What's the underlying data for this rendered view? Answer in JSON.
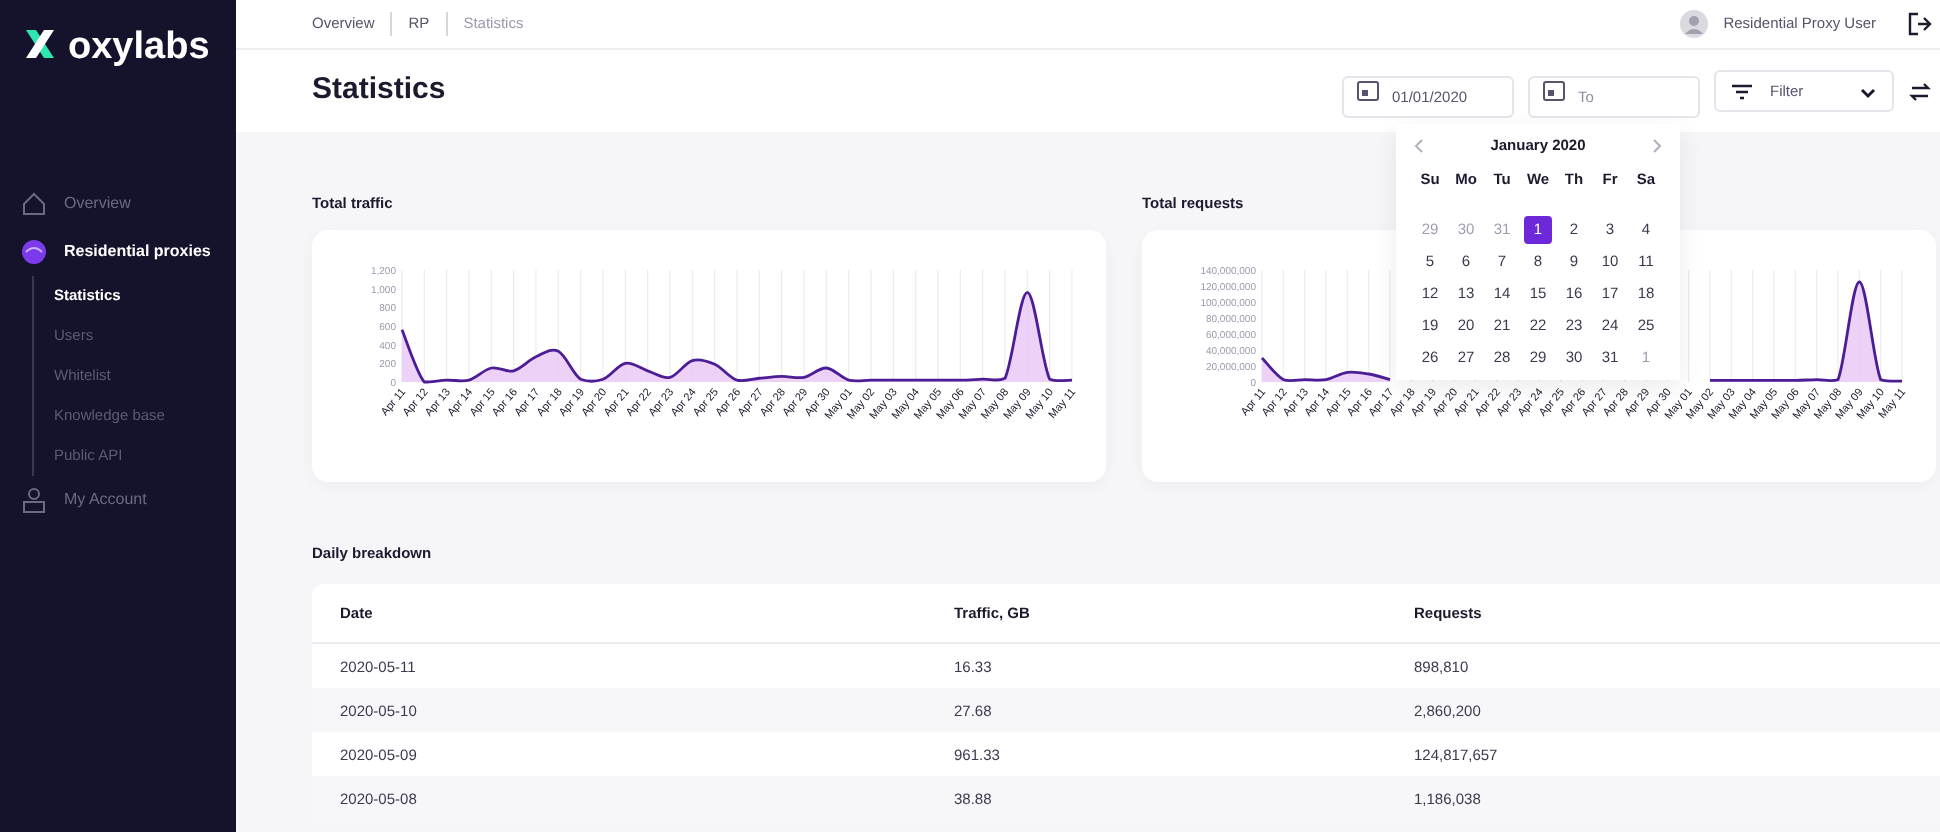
{
  "sidebar": {
    "logo": "oxylabs",
    "items": [
      {
        "label": "Overview",
        "selected": false
      },
      {
        "label": "Residential proxies",
        "selected": true,
        "children": [
          {
            "label": "Statistics",
            "selected": true
          },
          {
            "label": "Users",
            "selected": false
          },
          {
            "label": "Whitelist",
            "selected": false
          },
          {
            "label": "Knowledge base",
            "selected": false
          },
          {
            "label": "Public API",
            "selected": false
          }
        ]
      },
      {
        "label": "My Account",
        "selected": false
      }
    ]
  },
  "breadcrumbs": [
    "Overview",
    "RP",
    "Statistics"
  ],
  "user": {
    "name": "Residential Proxy User"
  },
  "page_title": "Statistics",
  "toolbar": {
    "from_date": {
      "value": "01/01/2020"
    },
    "to_date": {
      "placeholder": "To"
    },
    "filter": {
      "label": "Filter"
    }
  },
  "calendar": {
    "month": "January 2020",
    "weekdays": [
      "Su",
      "Mo",
      "Tu",
      "We",
      "Th",
      "Fr",
      "Sa"
    ],
    "days": [
      {
        "label": "29",
        "muted": true,
        "selected": false
      },
      {
        "label": "30",
        "muted": true,
        "selected": false
      },
      {
        "label": "31",
        "muted": true,
        "selected": false
      },
      {
        "label": "1",
        "muted": false,
        "selected": true
      },
      {
        "label": "2",
        "muted": false,
        "selected": false
      },
      {
        "label": "3",
        "muted": false,
        "selected": false
      },
      {
        "label": "4",
        "muted": false,
        "selected": false
      },
      {
        "label": "5",
        "muted": false,
        "selected": false
      },
      {
        "label": "6",
        "muted": false,
        "selected": false
      },
      {
        "label": "7",
        "muted": false,
        "selected": false
      },
      {
        "label": "8",
        "muted": false,
        "selected": false
      },
      {
        "label": "9",
        "muted": false,
        "selected": false
      },
      {
        "label": "10",
        "muted": false,
        "selected": false
      },
      {
        "label": "11",
        "muted": false,
        "selected": false
      },
      {
        "label": "12",
        "muted": false,
        "selected": false
      },
      {
        "label": "13",
        "muted": false,
        "selected": false
      },
      {
        "label": "14",
        "muted": false,
        "selected": false
      },
      {
        "label": "15",
        "muted": false,
        "selected": false
      },
      {
        "label": "16",
        "muted": false,
        "selected": false
      },
      {
        "label": "17",
        "muted": false,
        "selected": false
      },
      {
        "label": "18",
        "muted": false,
        "selected": false
      },
      {
        "label": "19",
        "muted": false,
        "selected": false
      },
      {
        "label": "20",
        "muted": false,
        "selected": false
      },
      {
        "label": "21",
        "muted": false,
        "selected": false
      },
      {
        "label": "22",
        "muted": false,
        "selected": false
      },
      {
        "label": "23",
        "muted": false,
        "selected": false
      },
      {
        "label": "24",
        "muted": false,
        "selected": false
      },
      {
        "label": "25",
        "muted": false,
        "selected": false
      },
      {
        "label": "26",
        "muted": false,
        "selected": false
      },
      {
        "label": "27",
        "muted": false,
        "selected": false
      },
      {
        "label": "28",
        "muted": false,
        "selected": false
      },
      {
        "label": "29",
        "muted": false,
        "selected": false
      },
      {
        "label": "30",
        "muted": false,
        "selected": false
      },
      {
        "label": "31",
        "muted": false,
        "selected": false
      },
      {
        "label": "1",
        "muted": true,
        "selected": false
      }
    ]
  },
  "charts": [
    {
      "title": "Total traffic",
      "chart_data": {
        "type": "area",
        "grid": true,
        "categories": [
          "Apr 11",
          "Apr 12",
          "Apr 13",
          "Apr 14",
          "Apr 15",
          "Apr 16",
          "Apr 17",
          "Apr 18",
          "Apr 19",
          "Apr 20",
          "Apr 21",
          "Apr 22",
          "Apr 23",
          "Apr 24",
          "Apr 25",
          "Apr 26",
          "Apr 27",
          "Apr 28",
          "Apr 29",
          "Apr 30",
          "May 01",
          "May 02",
          "May 03",
          "May 04",
          "May 05",
          "May 06",
          "May 07",
          "May 08",
          "May 09",
          "May 10",
          "May 11"
        ],
        "series": [
          {
            "color": "#4c1d95",
            "values": [
              560,
              0,
              20,
              20,
              150,
              120,
              270,
              330,
              30,
              30,
              200,
              120,
              50,
              230,
              190,
              20,
              40,
              60,
              50,
              150,
              20,
              20,
              20,
              20,
              20,
              20,
              30,
              40,
              960,
              30,
              20
            ]
          }
        ],
        "ylim": [
          0,
          1200
        ],
        "yticks": [
          {
            "value": 0,
            "label": "0"
          },
          {
            "value": 200,
            "label": "200"
          },
          {
            "value": 400,
            "label": "400"
          },
          {
            "value": 600,
            "label": "600"
          },
          {
            "value": 800,
            "label": "800"
          },
          {
            "value": 1000,
            "label": "1,000"
          },
          {
            "value": 1200,
            "label": "1,200"
          }
        ]
      }
    },
    {
      "title": "Total requests",
      "chart_data": {
        "type": "area",
        "grid": true,
        "categories": [
          "Apr 11",
          "Apr 12",
          "Apr 13",
          "Apr 14",
          "Apr 15",
          "Apr 16",
          "Apr 17",
          "Apr 18",
          "Apr 19",
          "Apr 20",
          "Apr 21",
          "Apr 22",
          "Apr 23",
          "Apr 24",
          "Apr 25",
          "Apr 26",
          "Apr 27",
          "Apr 28",
          "Apr 29",
          "Apr 30",
          "May 01",
          "May 02",
          "May 03",
          "May 04",
          "May 05",
          "May 06",
          "May 07",
          "May 08",
          "May 09",
          "May 10",
          "May 11"
        ],
        "series": [
          {
            "color": "#4c1d95",
            "values": [
              30000000,
              3000000,
              3000000,
              3000000,
              12000000,
              10000000,
              3000000,
              null,
              null,
              null,
              null,
              null,
              null,
              null,
              null,
              null,
              null,
              null,
              null,
              null,
              null,
              2000000,
              2000000,
              2000000,
              2000000,
              2000000,
              3000000,
              3000000,
              125000000,
              3000000,
              1000000
            ]
          }
        ],
        "ylim": [
          0,
          140000000
        ],
        "yticks": [
          {
            "value": 0,
            "label": "0"
          },
          {
            "value": 20000000,
            "label": "20,000,000"
          },
          {
            "value": 40000000,
            "label": "40,000,000"
          },
          {
            "value": 60000000,
            "label": "60,000,000"
          },
          {
            "value": 80000000,
            "label": "80,000,000"
          },
          {
            "value": 100000000,
            "label": "100,000,000"
          },
          {
            "value": 120000000,
            "label": "120,000,000"
          },
          {
            "value": 140000000,
            "label": "140,000,000"
          }
        ]
      }
    }
  ],
  "breakdown": {
    "title": "Daily breakdown",
    "columns": [
      "Date",
      "Traffic, GB",
      "Requests"
    ],
    "rows": [
      [
        "2020-05-11",
        "16.33",
        "898,810"
      ],
      [
        "2020-05-10",
        "27.68",
        "2,860,200"
      ],
      [
        "2020-05-09",
        "961.33",
        "124,817,657"
      ],
      [
        "2020-05-08",
        "38.88",
        "1,186,038"
      ]
    ]
  }
}
